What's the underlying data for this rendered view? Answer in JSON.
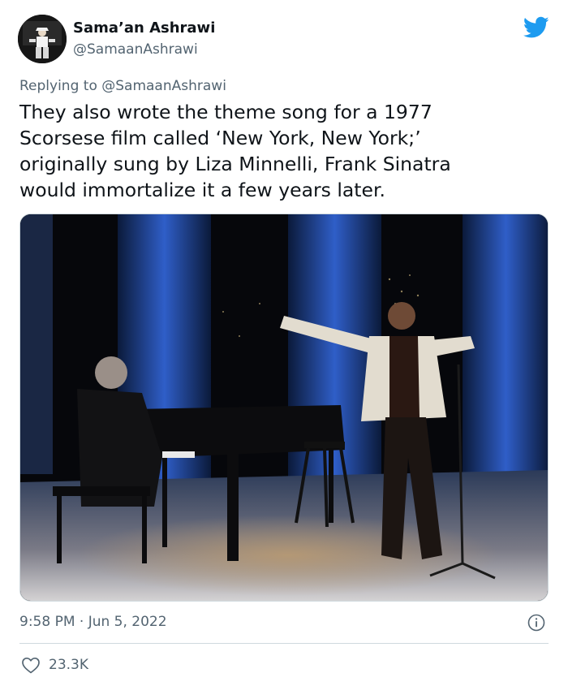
{
  "user": {
    "display_name": "Sama’an Ashrawi",
    "handle": "@SamaanAshrawi"
  },
  "reply": {
    "prefix": "Replying to ",
    "mention": "@SamaanAshrawi"
  },
  "tweet": {
    "lines": [
      "They also wrote the theme song for a 1977",
      "Scorsese film called ‘New York, New York;’",
      "originally sung by Liza Minnelli, Frank Sinatra",
      "would immortalize it a few years later."
    ]
  },
  "meta": {
    "timestamp": "9:58 PM · Jun 5, 2022",
    "likes": "23.3K"
  },
  "colors": {
    "brand": "#1d9bf0",
    "secondary_text": "#536471",
    "divider": "#cfd9de"
  },
  "icons": {
    "brand": "twitter-bird-icon",
    "info": "info-circle-icon",
    "like": "heart-outline-icon"
  }
}
